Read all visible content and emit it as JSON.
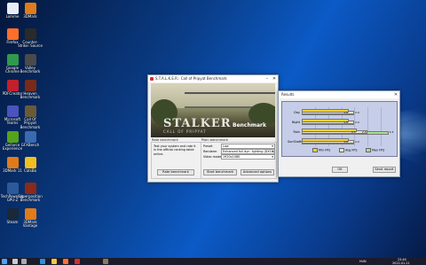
{
  "desktop": {
    "icons": [
      {
        "label": "Lomme",
        "color": "#e9eef6"
      },
      {
        "label": "3DMark",
        "color": "#e07b1a"
      },
      {
        "label": "Firefox",
        "color": "#ff6f2c"
      },
      {
        "label": "Counter-Strike: Source",
        "color": "#2a2a2a"
      },
      {
        "label": "Google Chrome",
        "color": "#2e9a4c"
      },
      {
        "label": "Valley Benchmark",
        "color": "#4a4a4a"
      },
      {
        "label": "PDFCreator",
        "color": "#c2202a"
      },
      {
        "label": "Heaven Benchmark",
        "color": "#7a2a1a"
      },
      {
        "label": "Microsoft Teams",
        "color": "#4b53bc"
      },
      {
        "label": "Call Of Pripyat Benchmark",
        "color": "#6b5a3a"
      },
      {
        "label": "GeForce Experience",
        "color": "#55a31a"
      },
      {
        "label": "GFXBench",
        "color": "#3a6ab0"
      },
      {
        "label": "3DMark 11",
        "color": "#e07b1a"
      },
      {
        "label": "CatsBo",
        "color": "#f0c020"
      },
      {
        "label": "TechPowerUp GPU-Z",
        "color": "#2a5a9a"
      },
      {
        "label": "Superposition Benchmark",
        "color": "#8a2a1a"
      },
      {
        "label": "Steam",
        "color": "#1b2838"
      },
      {
        "label": "3DMark Vantage",
        "color": "#e07b1a"
      }
    ]
  },
  "stalker": {
    "title": "S.T.A.L.K.E.R.: Call of Pripyat Benchmark",
    "logo": "STALKER",
    "subtitle": "CALL OF PRIPYAT",
    "benchmark_label": "Benchmark",
    "rate": {
      "group_title": "Rate benchmark",
      "desc": "Test your system and rate it in the official ranking table online.",
      "button": "Rate benchmark"
    },
    "plain": {
      "group_title": "Plain benchmark",
      "preset_label": "Preset",
      "preset_value": "Low",
      "renderer_label": "Renderer",
      "renderer_value": "Enhanced full dyn. lighting (DX11)",
      "mode_label": "Video mode",
      "mode_value": "1920x1080",
      "start_button": "Start benchmark",
      "advanced_button": "Advanced options"
    }
  },
  "results": {
    "title": "Results",
    "close_glyph": "✕",
    "ok_button": "OK",
    "send_button": "Send report",
    "chart_data": {
      "type": "bar",
      "categories": [
        "Day",
        "Night",
        "Rain",
        "SunShafts"
      ],
      "series": [
        {
          "name": "Min FPS",
          "color": "#f5d03a",
          "values": [
            1.8,
            1.8,
            2.1,
            1.8
          ]
        },
        {
          "name": "Avg FPS",
          "color": "#e8e2c8",
          "values": [
            2.0,
            2.0,
            2.5,
            2.0
          ]
        },
        {
          "name": "Max FPS",
          "color": "#a6e08a",
          "values": [
            2.0,
            2.0,
            3.3,
            2.0
          ]
        }
      ],
      "xlim": [
        0,
        3.5
      ]
    }
  },
  "taskbar": {
    "time": "23:40",
    "date": "2022-01-11",
    "lang": "HUN",
    "icons": [
      "start-icon",
      "search-icon",
      "taskview-icon",
      "edge-icon",
      "explorer-icon",
      "firefox-icon",
      "pdf-icon",
      "stalker-icon"
    ]
  }
}
